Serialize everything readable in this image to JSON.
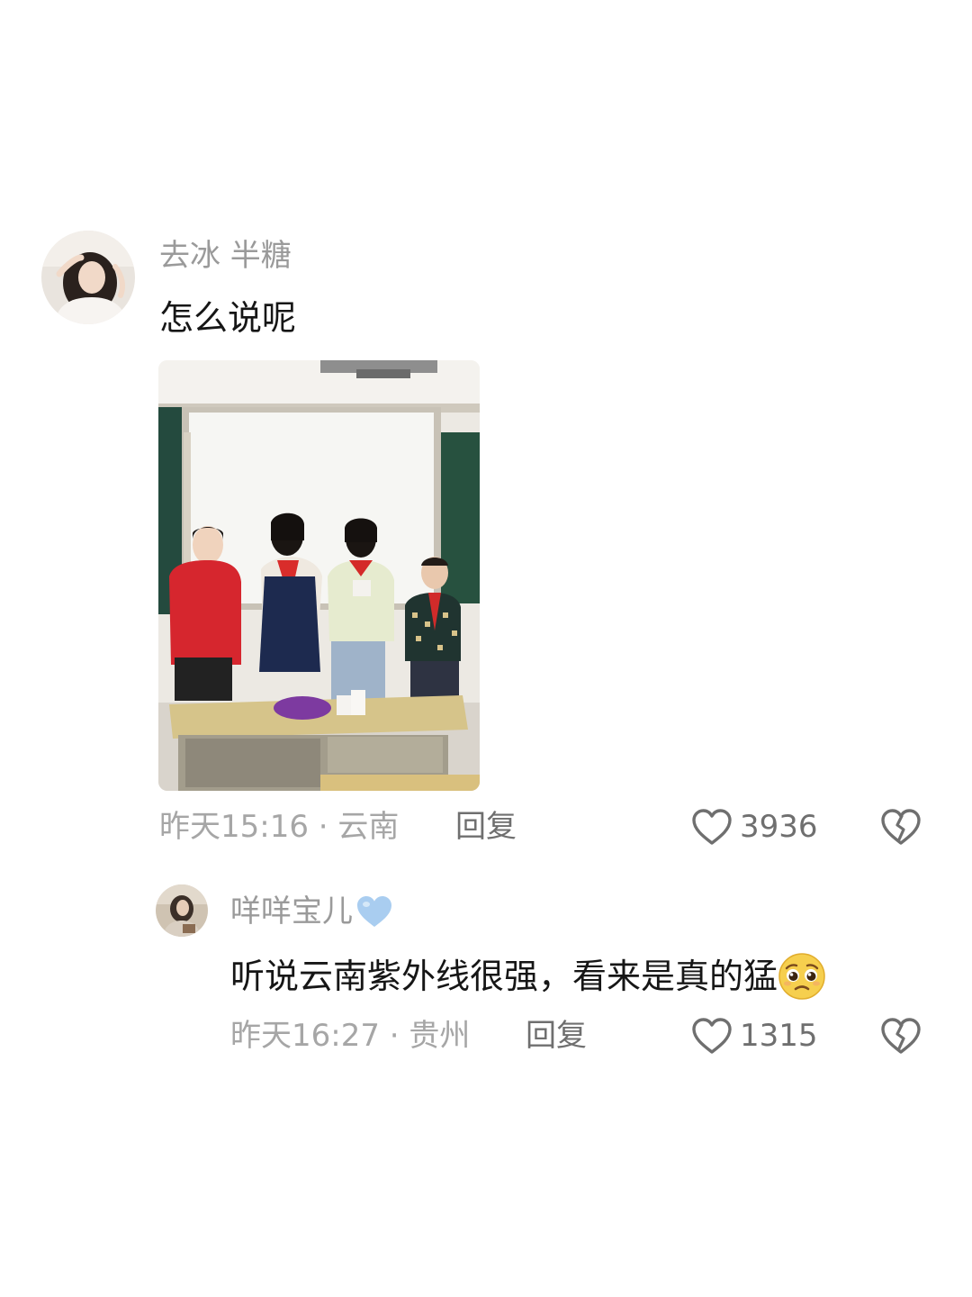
{
  "comments": [
    {
      "username": "去冰  半糖",
      "text": "怎么说呢",
      "time": "昨天15:16",
      "separator": " · ",
      "location": "云南",
      "reply_label": "回复",
      "like_count": "3936",
      "has_image": true,
      "avatar_icon": "avatar-photo"
    },
    {
      "username": "咩咩宝儿",
      "username_badge_icon": "light-blue-heart-icon",
      "text": "听说云南紫外线很强，看来是真的猛",
      "text_emoji_icon": "pleading-face-emoji",
      "time": "昨天16:27",
      "separator": " · ",
      "location": "贵州",
      "reply_label": "回复",
      "like_count": "1315",
      "avatar_icon": "avatar-photo"
    }
  ],
  "colors": {
    "username": "#9a9a9a",
    "text": "#161616",
    "meta": "#a6a6a6",
    "action": "#6f6f6f",
    "badge_heart": "#a9cdf0"
  }
}
